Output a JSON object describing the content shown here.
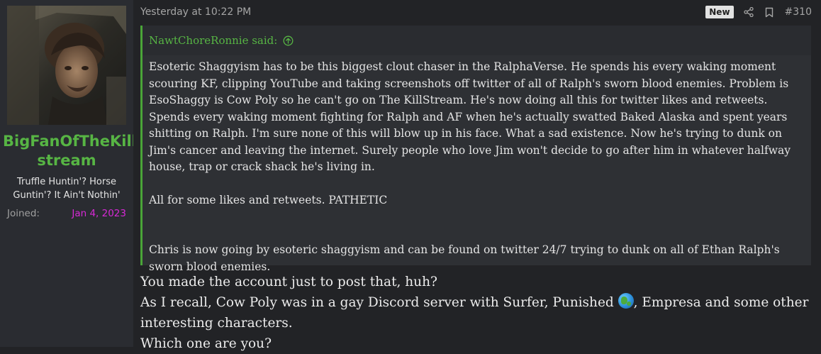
{
  "user": {
    "username_line1": "BigFanOfTheKill",
    "username_line2": "stream",
    "title_line1": "Truffle Huntin'? Horse",
    "title_line2": "Guntin'? It Ain't Nothin'",
    "joined_label": "Joined:",
    "joined_value": "Jan 4, 2023"
  },
  "post": {
    "timestamp": "Yesterday at 10:22 PM",
    "badge": "New",
    "share_icon": "share-icon",
    "bookmark_icon": "bookmark-icon",
    "number": "#310",
    "quote": {
      "author": "NawtChoreRonnie said:",
      "paragraphs": [
        "Esoteric Shaggyism has to be this biggest clout chaser in the RalphaVerse. He spends his every waking moment scouring KF, clipping YouTube and taking screenshots off twitter of all of Ralph's sworn blood enemies. Problem is EsoShaggy is Cow Poly so he can't go on The KillStream. He's now doing all this for twitter likes and retweets. Spends every waking moment fighting for Ralph and AF when he's actually swatted Baked Alaska and spent years shitting on Ralph. I'm sure none of this will blow up in his face. What a sad existence. Now he's trying to dunk on Jim's cancer and leaving the internet. Surely people who love Jim won't decide to go after him in whatever halfway house, trap or crack shack he's living in.",
        "All for some likes and retweets. PATHETIC",
        "Chris is now going by esoteric shaggyism and can be found on twitter 24/7 trying to dunk on all of Ethan Ralph's sworn blood enemies."
      ]
    },
    "reply": {
      "line1": "You made the account just to post that, huh?",
      "line2_before": "As I recall, Cow Poly was in a gay Discord server with Surfer, Punished ",
      "line2_after": ", Empresa and some other interesting characters.",
      "line3": "Which one are you?"
    }
  },
  "colors": {
    "username": "#57b544",
    "joined_value": "#d729d6",
    "quote_border": "#4aa538"
  }
}
